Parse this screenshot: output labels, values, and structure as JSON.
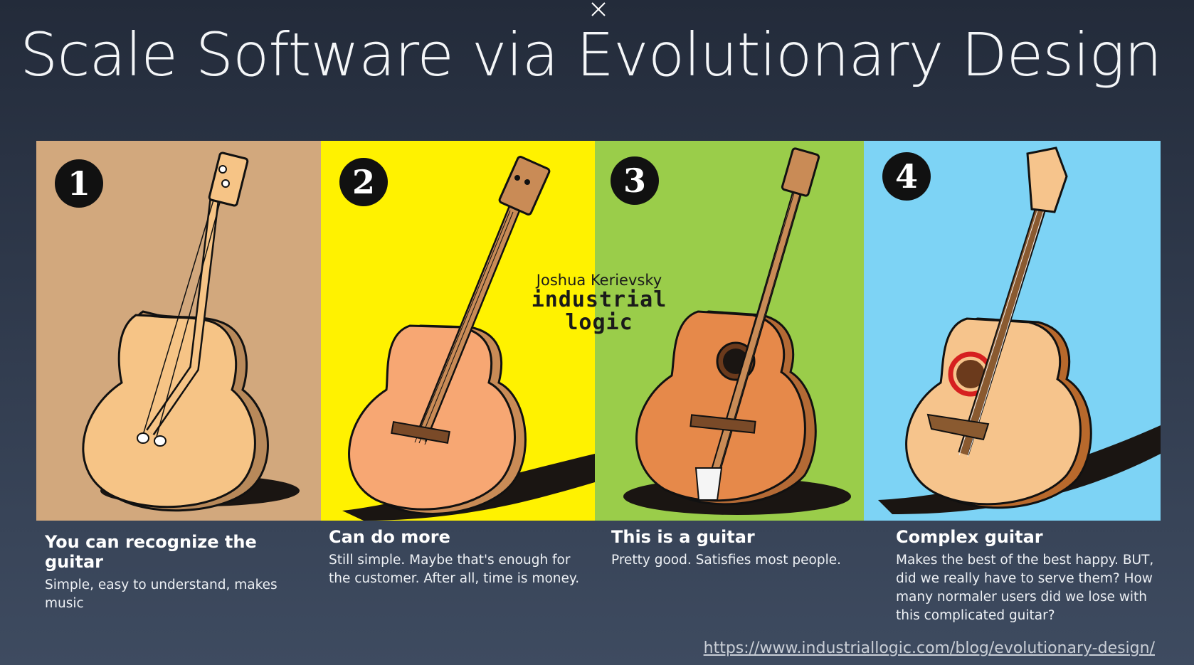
{
  "window": {
    "close_icon": "close-icon"
  },
  "slide": {
    "title": "Scale Software via Evolutionary Design",
    "watermark": {
      "author": "Joshua Kerievsky",
      "brand_line1": "industrial",
      "brand_line2": "logic"
    },
    "panels": [
      {
        "number": "1",
        "background": "#d2a87d",
        "heading": "You can recognize the guitar",
        "text": "Simple, easy to understand, makes music"
      },
      {
        "number": "2",
        "background": "#fff200",
        "heading": "Can do more",
        "text": "Still simple. Maybe that's enough for the customer. After all, time is money."
      },
      {
        "number": "3",
        "background": "#9acd4a",
        "heading": "This is a guitar",
        "text": "Pretty good. Satisfies most people."
      },
      {
        "number": "4",
        "background": "#7dd3f5",
        "heading": "Complex guitar",
        "text": "Makes the best of the best happy. BUT, did we really have to serve them? How many normaler users did we lose with this complicated guitar?"
      }
    ],
    "source_url": "https://www.industriallogic.com/blog/evolutionary-design/"
  }
}
